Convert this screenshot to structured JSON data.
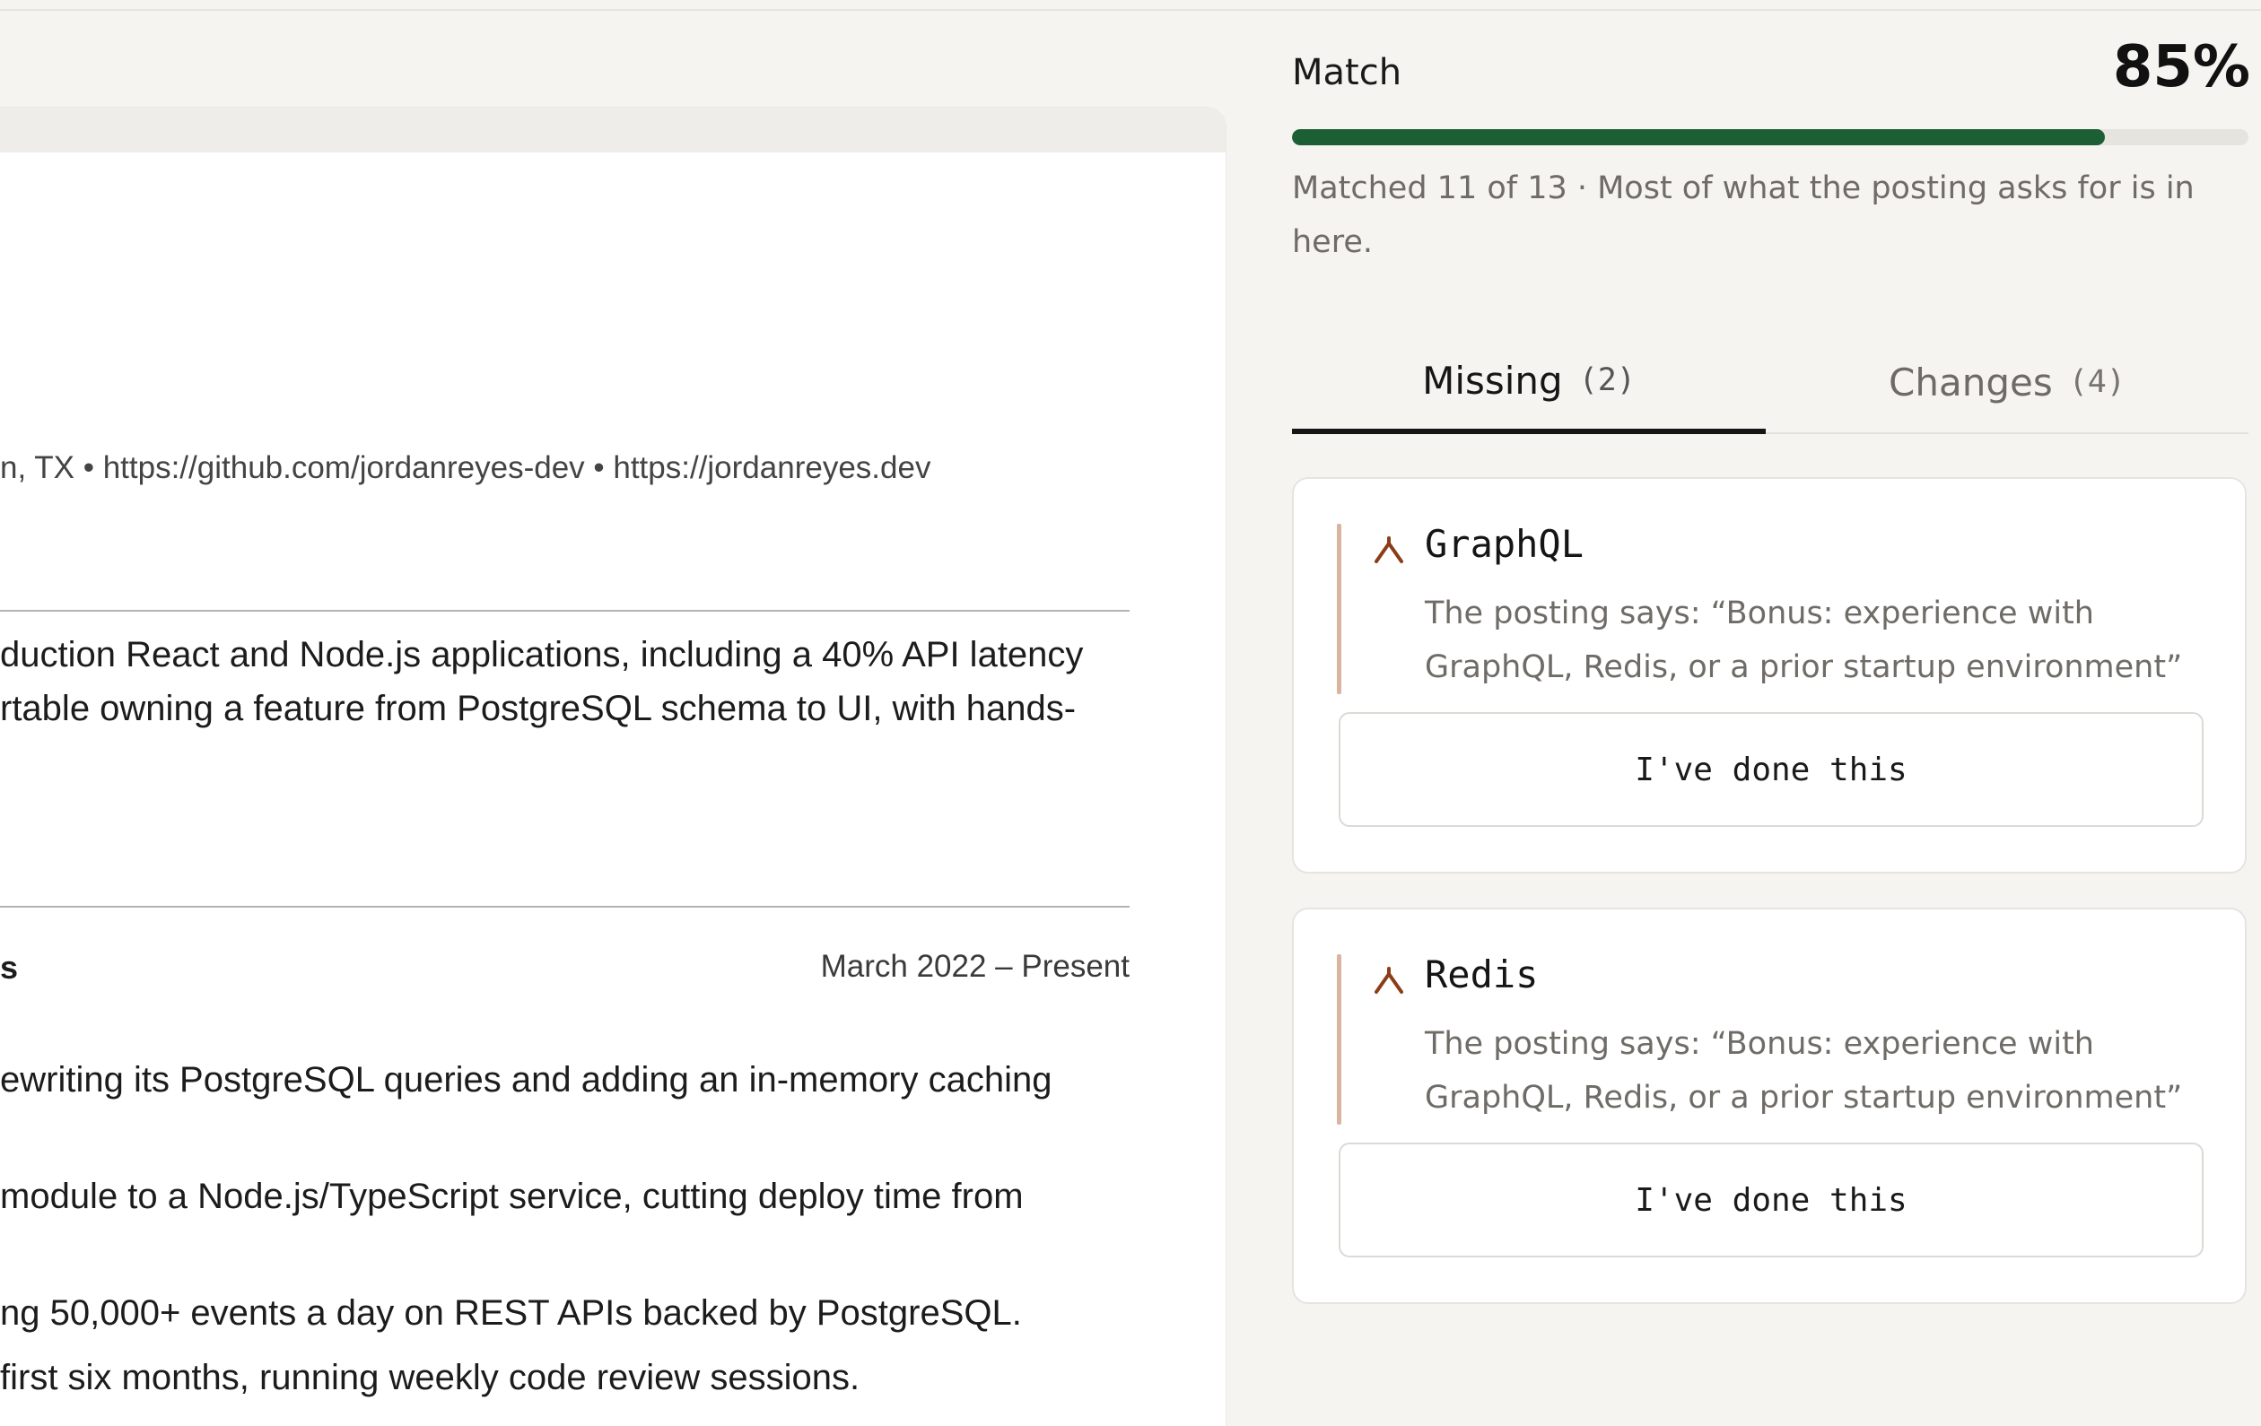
{
  "resume": {
    "contact_line": "n, TX • https://github.com/jordanreyes-dev • https://jordanreyes.dev",
    "summary_lines": [
      "duction React and Node.js applications, including a 40% API latency",
      "rtable owning a feature from PostgreSQL schema to UI, with hands-"
    ],
    "job": {
      "title_fragment": "s",
      "dates": "March 2022 – Present",
      "bullets": [
        "ewriting its PostgreSQL queries and adding an in-memory caching",
        " module to a Node.js/TypeScript service, cutting deploy time from",
        "ng 50,000+ events a day on REST APIs backed by PostgreSQL.",
        "first six months, running weekly code review sessions."
      ]
    }
  },
  "match": {
    "label": "Match",
    "percent_text": "85%",
    "percent": 0.85,
    "summary": "Matched 11 of 13 · Most of what the posting asks for is in here."
  },
  "tabs": [
    {
      "label": "Missing",
      "count": "(2)",
      "active": true
    },
    {
      "label": "Changes",
      "count": "(4)",
      "active": false
    }
  ],
  "missing_items": [
    {
      "icon": "chevron-up-icon",
      "title": "GraphQL",
      "quote": "The posting says: “Bonus: experience with GraphQL, Redis, or a prior startup environment”",
      "button": "I've done this"
    },
    {
      "icon": "chevron-up-icon",
      "title": "Redis",
      "quote": "The posting says: “Bonus: experience with GraphQL, Redis, or a prior startup environment”",
      "button": "I've done this"
    }
  ],
  "colors": {
    "accent_green": "#1d5f34",
    "icon_brown": "#8a3d18",
    "quote_rule": "#d8b4a2"
  }
}
